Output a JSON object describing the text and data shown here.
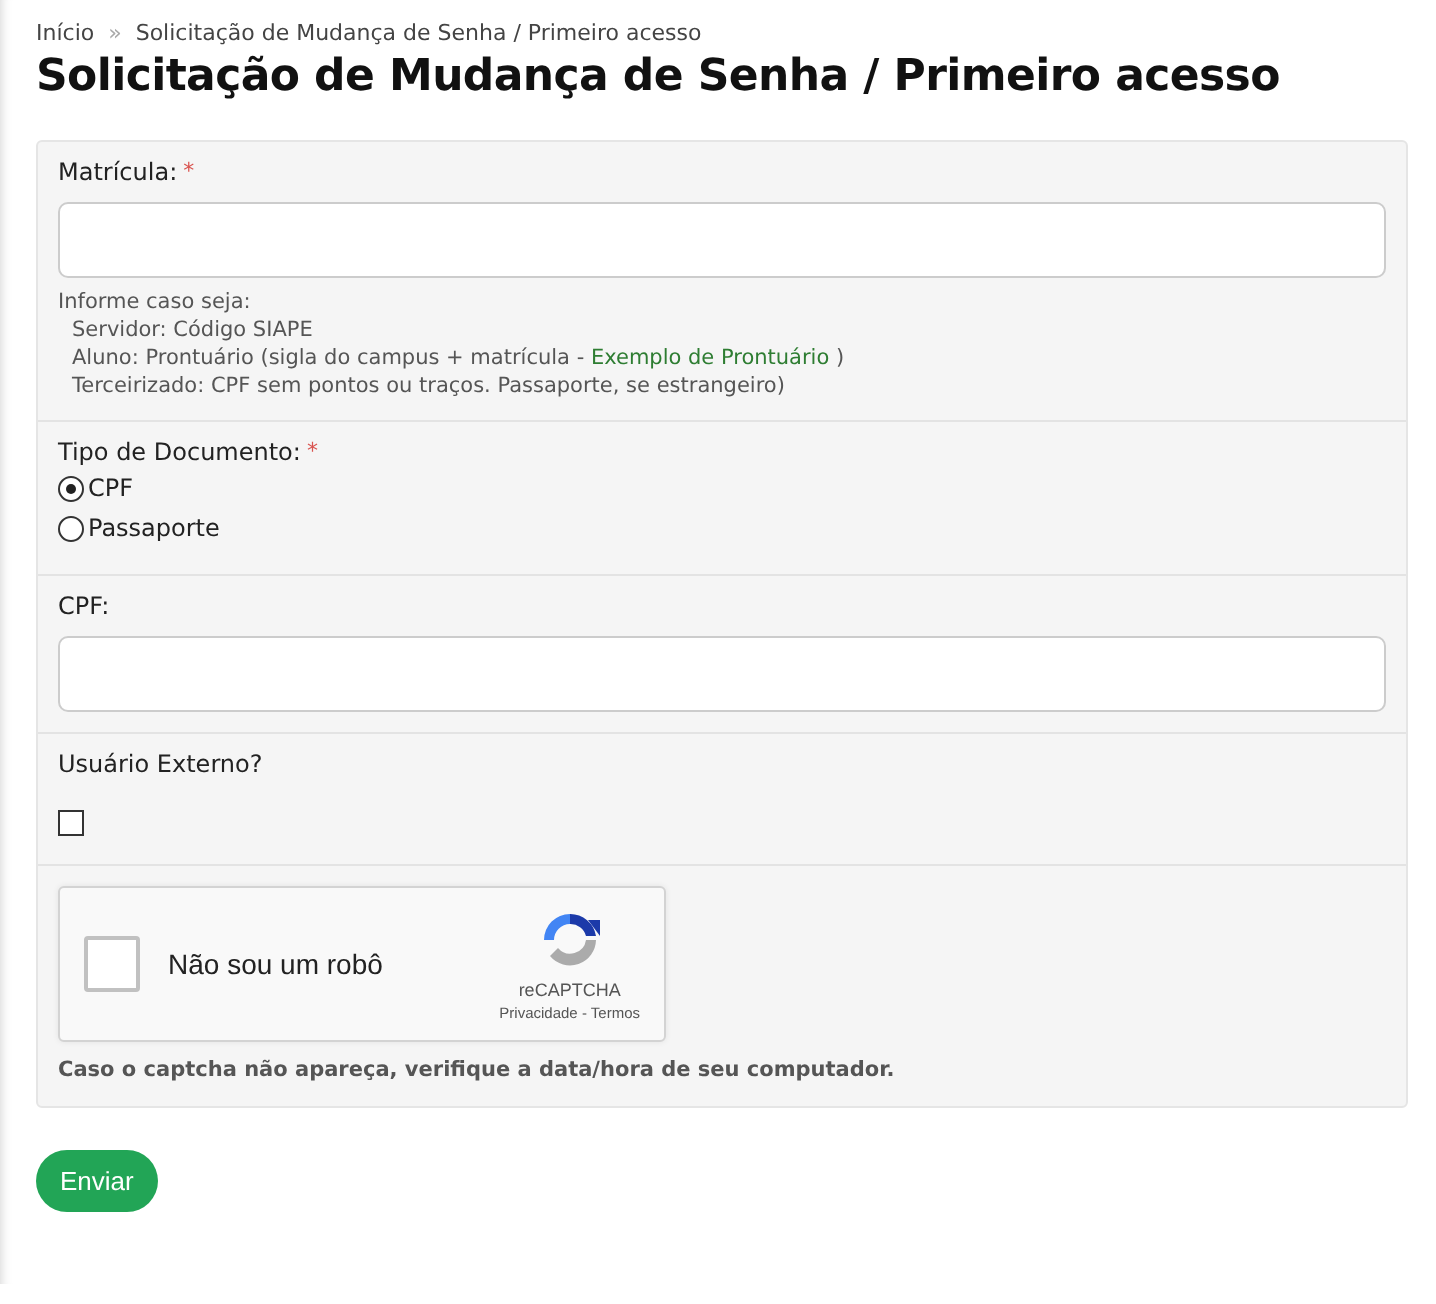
{
  "breadcrumb": {
    "items": [
      "Início",
      "Solicitação de Mudança de Senha / Primeiro acesso"
    ],
    "separator": "»"
  },
  "title": "Solicitação de Mudança de Senha / Primeiro acesso",
  "form": {
    "matricula": {
      "label": "Matrícula:",
      "required_mark": "*",
      "help_title": "Informe caso seja:",
      "help_lines": [
        {
          "text": "Servidor: Código SIAPE"
        },
        {
          "text": "Aluno: Prontuário (sigla do campus + matrícula - ",
          "link": "Exemplo de Prontuário",
          "after": " )"
        },
        {
          "text": "Terceirizado: CPF sem pontos ou traços. Passaporte, se estrangeiro)"
        }
      ]
    },
    "tipo_documento": {
      "label": "Tipo de Documento:",
      "required_mark": "*",
      "options": [
        {
          "label": "CPF",
          "selected": true
        },
        {
          "label": "Passaporte",
          "selected": false
        }
      ]
    },
    "cpf": {
      "label": "CPF:"
    },
    "usuario_externo": {
      "label": "Usuário Externo?",
      "checked": false
    },
    "captcha": {
      "label": "Não sou um robô",
      "checked": false,
      "brand": "reCAPTCHA",
      "links": [
        "Privacidade",
        "Termos"
      ],
      "links_separator": "-",
      "note": "Caso o captcha não apareça, verifique a data/hora de seu computador."
    }
  },
  "submit": "Enviar"
}
